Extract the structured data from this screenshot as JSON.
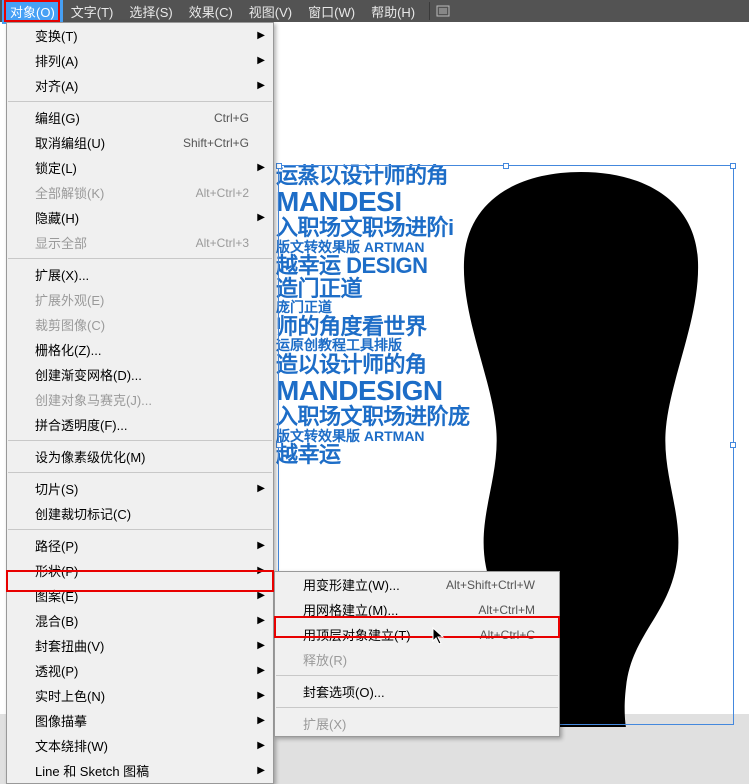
{
  "menubar": {
    "items": [
      "对象(O)",
      "文字(T)",
      "选择(S)",
      "效果(C)",
      "视图(V)",
      "窗口(W)",
      "帮助(H)"
    ]
  },
  "menu_main": {
    "groups": [
      [
        {
          "label": "变换(T)",
          "shortcut": "",
          "sub": true,
          "disabled": false
        },
        {
          "label": "排列(A)",
          "shortcut": "",
          "sub": true,
          "disabled": false
        },
        {
          "label": "对齐(A)",
          "shortcut": "",
          "sub": true,
          "disabled": false
        }
      ],
      [
        {
          "label": "编组(G)",
          "shortcut": "Ctrl+G",
          "sub": false,
          "disabled": false
        },
        {
          "label": "取消编组(U)",
          "shortcut": "Shift+Ctrl+G",
          "sub": false,
          "disabled": false
        },
        {
          "label": "锁定(L)",
          "shortcut": "",
          "sub": true,
          "disabled": false
        },
        {
          "label": "全部解锁(K)",
          "shortcut": "Alt+Ctrl+2",
          "sub": false,
          "disabled": true
        },
        {
          "label": "隐藏(H)",
          "shortcut": "",
          "sub": true,
          "disabled": false
        },
        {
          "label": "显示全部",
          "shortcut": "Alt+Ctrl+3",
          "sub": false,
          "disabled": true
        }
      ],
      [
        {
          "label": "扩展(X)...",
          "shortcut": "",
          "sub": false,
          "disabled": false
        },
        {
          "label": "扩展外观(E)",
          "shortcut": "",
          "sub": false,
          "disabled": true
        },
        {
          "label": "裁剪图像(C)",
          "shortcut": "",
          "sub": false,
          "disabled": true
        },
        {
          "label": "栅格化(Z)...",
          "shortcut": "",
          "sub": false,
          "disabled": false
        },
        {
          "label": "创建渐变网格(D)...",
          "shortcut": "",
          "sub": false,
          "disabled": false
        },
        {
          "label": "创建对象马赛克(J)...",
          "shortcut": "",
          "sub": false,
          "disabled": true
        },
        {
          "label": "拼合透明度(F)...",
          "shortcut": "",
          "sub": false,
          "disabled": false
        }
      ],
      [
        {
          "label": "设为像素级优化(M)",
          "shortcut": "",
          "sub": false,
          "disabled": false
        }
      ],
      [
        {
          "label": "切片(S)",
          "shortcut": "",
          "sub": true,
          "disabled": false
        },
        {
          "label": "创建裁切标记(C)",
          "shortcut": "",
          "sub": false,
          "disabled": false
        }
      ],
      [
        {
          "label": "路径(P)",
          "shortcut": "",
          "sub": true,
          "disabled": false
        },
        {
          "label": "形状(P)",
          "shortcut": "",
          "sub": true,
          "disabled": false
        },
        {
          "label": "图案(E)",
          "shortcut": "",
          "sub": true,
          "disabled": false
        },
        {
          "label": "混合(B)",
          "shortcut": "",
          "sub": true,
          "disabled": false
        },
        {
          "label": "封套扭曲(V)",
          "shortcut": "",
          "sub": true,
          "disabled": false
        },
        {
          "label": "透视(P)",
          "shortcut": "",
          "sub": true,
          "disabled": false
        },
        {
          "label": "实时上色(N)",
          "shortcut": "",
          "sub": true,
          "disabled": false
        },
        {
          "label": "图像描摹",
          "shortcut": "",
          "sub": true,
          "disabled": false
        },
        {
          "label": "文本绕排(W)",
          "shortcut": "",
          "sub": true,
          "disabled": false
        },
        {
          "label": "Line 和 Sketch 图稿",
          "shortcut": "",
          "sub": true,
          "disabled": false
        }
      ]
    ]
  },
  "menu_sub": {
    "groups": [
      [
        {
          "label": "用变形建立(W)...",
          "shortcut": "Alt+Shift+Ctrl+W",
          "disabled": false
        },
        {
          "label": "用网格建立(M)...",
          "shortcut": "Alt+Ctrl+M",
          "disabled": false
        },
        {
          "label": "用顶层对象建立(T)",
          "shortcut": "Alt+Ctrl+C",
          "disabled": false
        },
        {
          "label": "释放(R)",
          "shortcut": "",
          "disabled": true
        }
      ],
      [
        {
          "label": "封套选项(O)...",
          "shortcut": "",
          "disabled": false
        }
      ],
      [
        {
          "label": "扩展(X)",
          "shortcut": "",
          "disabled": true
        }
      ]
    ]
  },
  "bg": {
    "l1": "运蒸以设计师的角",
    "l2": "MANDESI",
    "l3": "入职场文职场进阶i",
    "l4": "版文转效果版 ARTMAN",
    "l5": "越幸运 DESIGN",
    "l6": "造门正道",
    "l7": "庞门正道",
    "l8": "师的角度看世界",
    "l9": "运原创教程工具排版",
    "l10": "造以设计师的角",
    "l11": "MANDESIGN",
    "l12": "入职场文职场进阶庞",
    "l13": "版文转效果版 ARTMAN",
    "l14": "越幸运"
  }
}
